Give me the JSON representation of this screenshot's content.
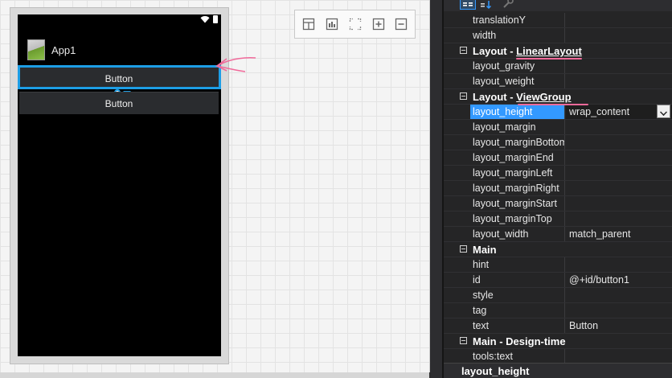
{
  "designer": {
    "app_title": "App1",
    "buttons": [
      {
        "label": "Button"
      },
      {
        "label": "Button"
      }
    ],
    "toolbar": [
      "layout-horizontal-icon",
      "layout-table-icon",
      "fit-screen-icon",
      "zoom-in-icon",
      "zoom-out-icon"
    ]
  },
  "properties": {
    "rows": [
      {
        "type": "prop",
        "name": "translationY",
        "value": ""
      },
      {
        "type": "prop",
        "name": "width",
        "value": ""
      },
      {
        "type": "cat",
        "name": "Layout - ",
        "sub": "LinearLayout"
      },
      {
        "type": "prop",
        "name": "layout_gravity",
        "value": ""
      },
      {
        "type": "prop",
        "name": "layout_weight",
        "value": ""
      },
      {
        "type": "cat",
        "name": "Layout - ",
        "sub": "ViewGroup"
      },
      {
        "type": "prop",
        "name": "layout_height",
        "value": "wrap_content",
        "selected": true
      },
      {
        "type": "prop",
        "name": "layout_margin",
        "value": ""
      },
      {
        "type": "prop",
        "name": "layout_marginBottom",
        "value": ""
      },
      {
        "type": "prop",
        "name": "layout_marginEnd",
        "value": ""
      },
      {
        "type": "prop",
        "name": "layout_marginLeft",
        "value": ""
      },
      {
        "type": "prop",
        "name": "layout_marginRight",
        "value": ""
      },
      {
        "type": "prop",
        "name": "layout_marginStart",
        "value": ""
      },
      {
        "type": "prop",
        "name": "layout_marginTop",
        "value": ""
      },
      {
        "type": "prop",
        "name": "layout_width",
        "value": "match_parent"
      },
      {
        "type": "cat",
        "name": "Main",
        "sub": ""
      },
      {
        "type": "prop",
        "name": "hint",
        "value": ""
      },
      {
        "type": "prop",
        "name": "id",
        "value": "@+id/button1"
      },
      {
        "type": "prop",
        "name": "style",
        "value": ""
      },
      {
        "type": "prop",
        "name": "tag",
        "value": ""
      },
      {
        "type": "prop",
        "name": "text",
        "value": "Button"
      },
      {
        "type": "cat",
        "name": "Main - Design-time",
        "sub": ""
      },
      {
        "type": "prop",
        "name": "tools:text",
        "value": ""
      }
    ],
    "description_title": "layout_height"
  },
  "colors": {
    "selection": "#1d9ee6",
    "annotation": "#f06a9a",
    "selected_row": "#3399ff"
  }
}
